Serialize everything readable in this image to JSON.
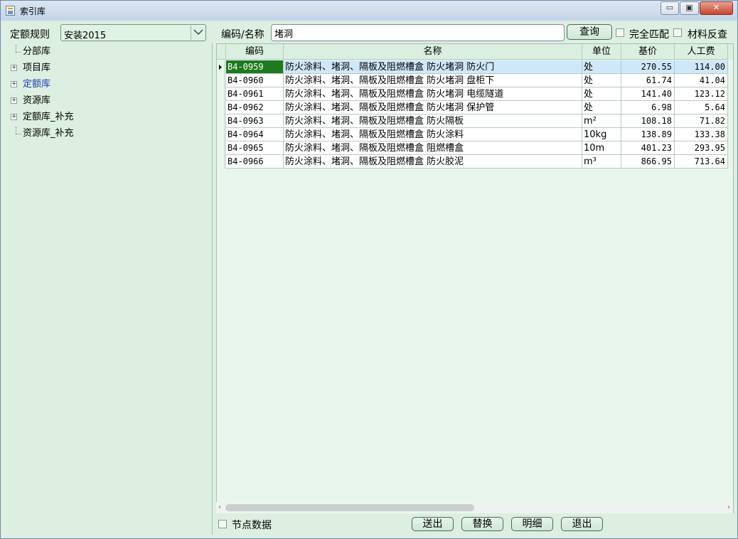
{
  "window": {
    "title": "索引库",
    "min_label": "▭",
    "max_label": "▣",
    "close_label": "✕"
  },
  "left": {
    "rule_label": "定额规则",
    "rule_value": "安装2015",
    "tree": [
      {
        "label": "分部库",
        "expandable": false
      },
      {
        "label": "项目库",
        "expandable": true
      },
      {
        "label": "定额库",
        "expandable": true,
        "selected": true
      },
      {
        "label": "资源库",
        "expandable": true
      },
      {
        "label": "定额库_补充",
        "expandable": true
      },
      {
        "label": "资源库_补充",
        "expandable": false
      }
    ]
  },
  "search": {
    "label": "编码/名称",
    "value": "堵洞",
    "query_button": "查询",
    "exact_match_label": "完全匹配",
    "material_reverse_label": "材料反查"
  },
  "table": {
    "headers": [
      "编码",
      "名称",
      "单位",
      "基价",
      "人工费"
    ],
    "rows": [
      {
        "code": "B4-0959",
        "name": "防火涂料、堵洞、隔板及阻燃槽盒 防火堵洞 防火门",
        "unit": "处",
        "base_price": "270.55",
        "labor": "114.00"
      },
      {
        "code": "B4-0960",
        "name": "防火涂料、堵洞、隔板及阻燃槽盒 防火堵洞 盘柜下",
        "unit": "处",
        "base_price": "61.74",
        "labor": "41.04"
      },
      {
        "code": "B4-0961",
        "name": "防火涂料、堵洞、隔板及阻燃槽盒 防火堵洞 电缆隧道",
        "unit": "处",
        "base_price": "141.40",
        "labor": "123.12"
      },
      {
        "code": "B4-0962",
        "name": "防火涂料、堵洞、隔板及阻燃槽盒 防火堵洞 保护管",
        "unit": "处",
        "base_price": "6.98",
        "labor": "5.64"
      },
      {
        "code": "B4-0963",
        "name": "防火涂料、堵洞、隔板及阻燃槽盒 防火隔板",
        "unit": "m²",
        "base_price": "108.18",
        "labor": "71.82"
      },
      {
        "code": "B4-0964",
        "name": "防火涂料、堵洞、隔板及阻燃槽盒 防火涂料",
        "unit": "10kg",
        "base_price": "138.89",
        "labor": "133.38"
      },
      {
        "code": "B4-0965",
        "name": "防火涂料、堵洞、隔板及阻燃槽盒 阻燃槽盒",
        "unit": "10m",
        "base_price": "401.23",
        "labor": "293.95"
      },
      {
        "code": "B4-0966",
        "name": "防火涂料、堵洞、隔板及阻燃槽盒 防火胶泥",
        "unit": "m³",
        "base_price": "866.95",
        "labor": "713.64"
      }
    ]
  },
  "bottom": {
    "node_data_label": "节点数据",
    "send_button": "送出",
    "replace_button": "替换",
    "detail_button": "明细",
    "exit_button": "退出"
  }
}
